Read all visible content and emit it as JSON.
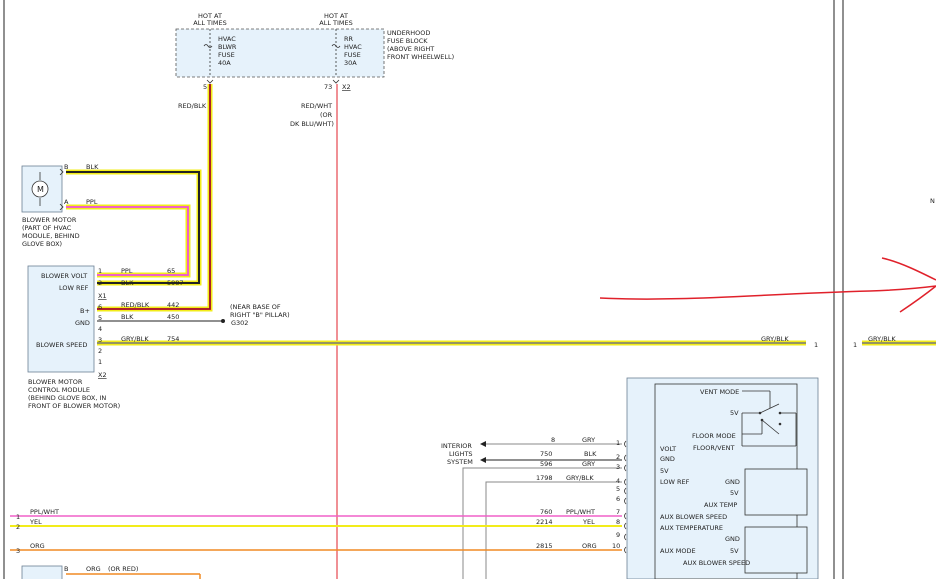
{
  "fuse_block": {
    "hot1_line1": "HOT AT",
    "hot1_line2": "ALL TIMES",
    "hot2_line1": "HOT AT",
    "hot2_line2": "ALL TIMES",
    "fuse1": [
      "HVAC",
      "BLWR",
      "FUSE",
      "40A"
    ],
    "fuse2": [
      "RR",
      "HVAC",
      "FUSE",
      "30A"
    ],
    "label": [
      "UNDERHOOD",
      "FUSE BLOCK",
      "(ABOVE RIGHT",
      "FRONT WHEELWELL)"
    ],
    "pin1": "5",
    "pin2": "73",
    "conn": "X2"
  },
  "wires_top": {
    "w1": "RED/BLK",
    "w2": [
      "RED/WHT",
      "(OR",
      "DK BLU/WHT)"
    ]
  },
  "blower_motor": {
    "pin_b": "B",
    "pin_a": "A",
    "wire_b": "BLK",
    "wire_a": "PPL",
    "label": [
      "BLOWER MOTOR",
      "(PART OF HVAC",
      "MODULE, BEHIND",
      "GLOVE BOX)"
    ]
  },
  "control_module": {
    "rows": [
      {
        "label": "BLOWER VOLT",
        "pin": "1",
        "wire": "PPL",
        "circuit": "65"
      },
      {
        "label": "LOW REF",
        "pin": "2",
        "wire": "BLK",
        "circuit": "5987"
      },
      {
        "label": "",
        "pin": "X1",
        "wire": "",
        "circuit": ""
      },
      {
        "label": "B+",
        "pin": "6",
        "wire": "RED/BLK",
        "circuit": "442"
      },
      {
        "label": "GND",
        "pin": "5",
        "wire": "BLK",
        "circuit": "450"
      },
      {
        "label": "",
        "pin": "4",
        "wire": "",
        "circuit": ""
      },
      {
        "label": "BLOWER SPEED",
        "pin": "3",
        "wire": "GRY/BLK",
        "circuit": "754"
      },
      {
        "label": "",
        "pin": "2",
        "wire": "",
        "circuit": ""
      },
      {
        "label": "",
        "pin": "1",
        "wire": "",
        "circuit": ""
      },
      {
        "label": "",
        "pin": "X2",
        "wire": "",
        "circuit": ""
      }
    ],
    "ground_note": [
      "(NEAR BASE OF",
      "RIGHT \"B\" PILLAR)"
    ],
    "ground_id": "G302",
    "label": [
      "BLOWER MOTOR",
      "CONTROL MODULE",
      "(BEHIND GLOVE BOX, IN",
      "FRONT OF BLOWER MOTOR)"
    ]
  },
  "speed_line": {
    "wire": "GRY/BLK",
    "pin": "1",
    "right_pin": "1",
    "right_wire": "GRY/BLK"
  },
  "interior_lights": [
    "INTERIOR",
    "LIGHTS",
    "SYSTEM"
  ],
  "aux_rows": [
    {
      "circuit": "8",
      "wire": "GRY",
      "pin": "1",
      "label": "VOLT"
    },
    {
      "circuit": "750",
      "wire": "BLK",
      "pin": "2",
      "label": "GND"
    },
    {
      "circuit": "596",
      "wire": "GRY",
      "pin": "3",
      "label": "5V"
    },
    {
      "circuit": "1798",
      "wire": "GRY/BLK",
      "pin": "4",
      "label": "LOW REF"
    },
    {
      "circuit": "",
      "wire": "",
      "pin": "5",
      "label": ""
    },
    {
      "circuit": "",
      "wire": "",
      "pin": "6",
      "label": ""
    },
    {
      "circuit": "760",
      "wire": "PPL/WHT",
      "pin": "7",
      "label": "AUX BLOWER SPEED"
    },
    {
      "circuit": "2214",
      "wire": "YEL",
      "pin": "8",
      "label": "AUX TEMPERATURE"
    },
    {
      "circuit": "",
      "wire": "",
      "pin": "9",
      "label": ""
    },
    {
      "circuit": "2815",
      "wire": "ORG",
      "pin": "10",
      "label": "AUX MODE"
    }
  ],
  "aux_module": {
    "vent_mode": "VENT MODE",
    "fv": "5V",
    "floor_mode": "FLOOR MODE",
    "floor_vent": "FLOOR/VENT",
    "gnd1": "GND",
    "fv1": "5V",
    "aux_temp": "AUX TEMP",
    "gnd2": "GND",
    "fv2": "5V",
    "aux_blower_speed": "AUX BLOWER SPEED"
  },
  "left_feeds": [
    {
      "pin": "1",
      "wire": "PPL/WHT"
    },
    {
      "pin": "2",
      "wire": "YEL"
    },
    {
      "pin": "3",
      "wire": "ORG"
    }
  ],
  "bottom_motor": {
    "pin": "B",
    "wire": "ORG",
    "alt": "(OR RED)"
  },
  "right_fragment": {
    "letter": "N"
  },
  "colors": {
    "red": "#e0212b",
    "yellow": "#f2ec1a",
    "pink": "#f060c8",
    "orange": "#f08a24",
    "black": "#222222",
    "blue_fill": "#e6f2fb"
  }
}
